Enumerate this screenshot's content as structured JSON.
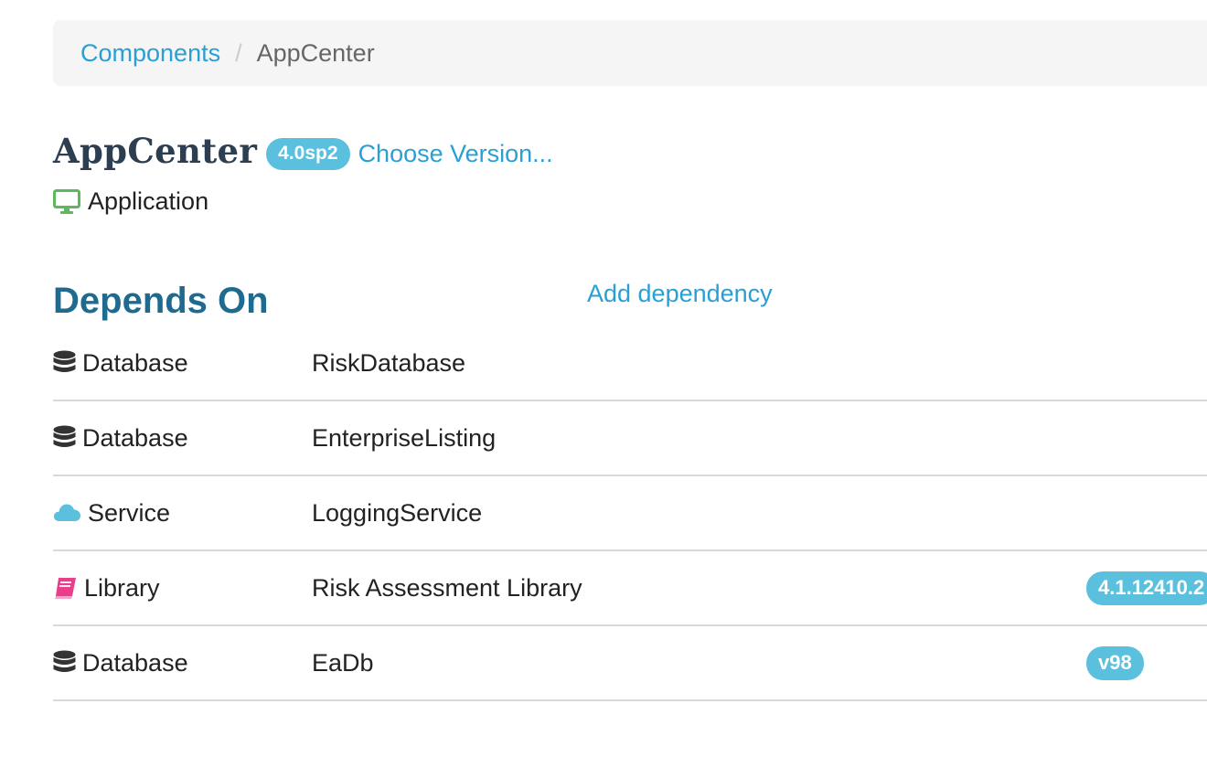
{
  "breadcrumb": {
    "parent": "Components",
    "separator": "/",
    "current": "AppCenter"
  },
  "component": {
    "name": "AppCenter",
    "version": "4.0sp2",
    "choose_version_label": "Choose Version...",
    "type_label": "Application",
    "type_icon": "desktop-icon"
  },
  "depends_on": {
    "title": "Depends On",
    "add_label": "Add dependency",
    "items": [
      {
        "type": "Database",
        "icon": "database-icon",
        "name": "RiskDatabase",
        "version": ""
      },
      {
        "type": "Database",
        "icon": "database-icon",
        "name": "EnterpriseListing",
        "version": ""
      },
      {
        "type": "Service",
        "icon": "cloud-icon",
        "name": "LoggingService",
        "version": ""
      },
      {
        "type": "Library",
        "icon": "book-icon",
        "name": "Risk Assessment Library",
        "version": "4.1.12410.2"
      },
      {
        "type": "Database",
        "icon": "database-icon",
        "name": "EaDb",
        "version": "v98"
      }
    ]
  },
  "colors": {
    "link": "#2a9fd6",
    "badge": "#5bc0de",
    "section_title": "#1f6b8f",
    "application_icon": "#5cb85c",
    "service_icon": "#5bc0de",
    "library_icon": "#e83e8c",
    "database_icon": "#333333"
  }
}
